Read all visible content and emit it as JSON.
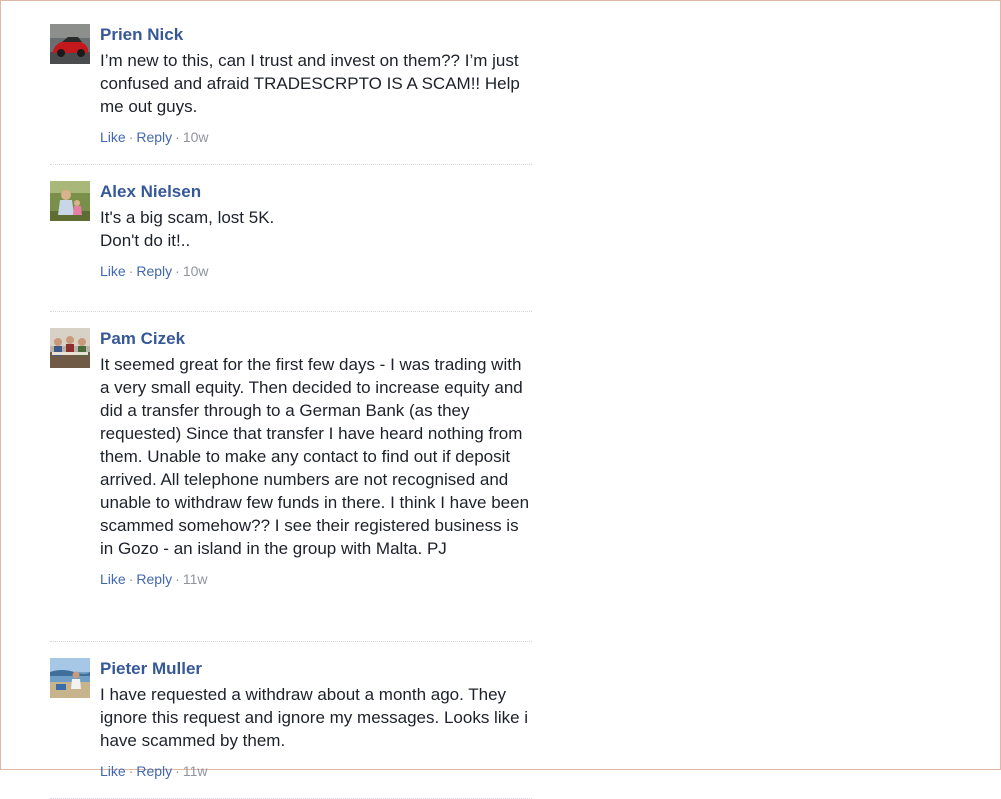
{
  "comments": [
    {
      "author": "Prien Nick",
      "text": "I’m new to this, can I trust and invest on them?? I’m just confused and afraid TRADESCRPTO IS A SCAM!! Help me out guys.",
      "like": "Like",
      "reply": "Reply",
      "time": "10w",
      "avatar_icon": "red-sports-car-photo"
    },
    {
      "author": "Alex Nielsen",
      "text": "It's a big scam, lost 5K.\nDon't do it!..",
      "like": "Like",
      "reply": "Reply",
      "time": "10w",
      "avatar_icon": "person-outdoors-photo"
    },
    {
      "author": "Pam Cizek",
      "text": "It seemed great for the first few days - I was trading with a very small equity. Then decided to increase equity and did a transfer through to a German Bank (as they requested) Since that transfer I have heard nothing from them. Unable to make any contact to find out if deposit arrived. All telephone numbers are not recognised and unable to withdraw few funds in there. I think I have been scammed somehow?? I see their registered business is in Gozo - an island in the group with Malta. PJ",
      "like": "Like",
      "reply": "Reply",
      "time": "11w",
      "avatar_icon": "people-at-table-photo"
    },
    {
      "author": "Pieter Muller",
      "text": "I have requested a withdraw about a month ago. They ignore this request and ignore my messages. Looks like i have scammed by them.",
      "like": "Like",
      "reply": "Reply",
      "time": "11w",
      "avatar_icon": "person-on-beach-photo"
    }
  ],
  "colors": {
    "author": "#365899",
    "link": "#4267b2",
    "meta": "#90949c",
    "text": "#1d2129",
    "divider": "#d3d6db"
  }
}
